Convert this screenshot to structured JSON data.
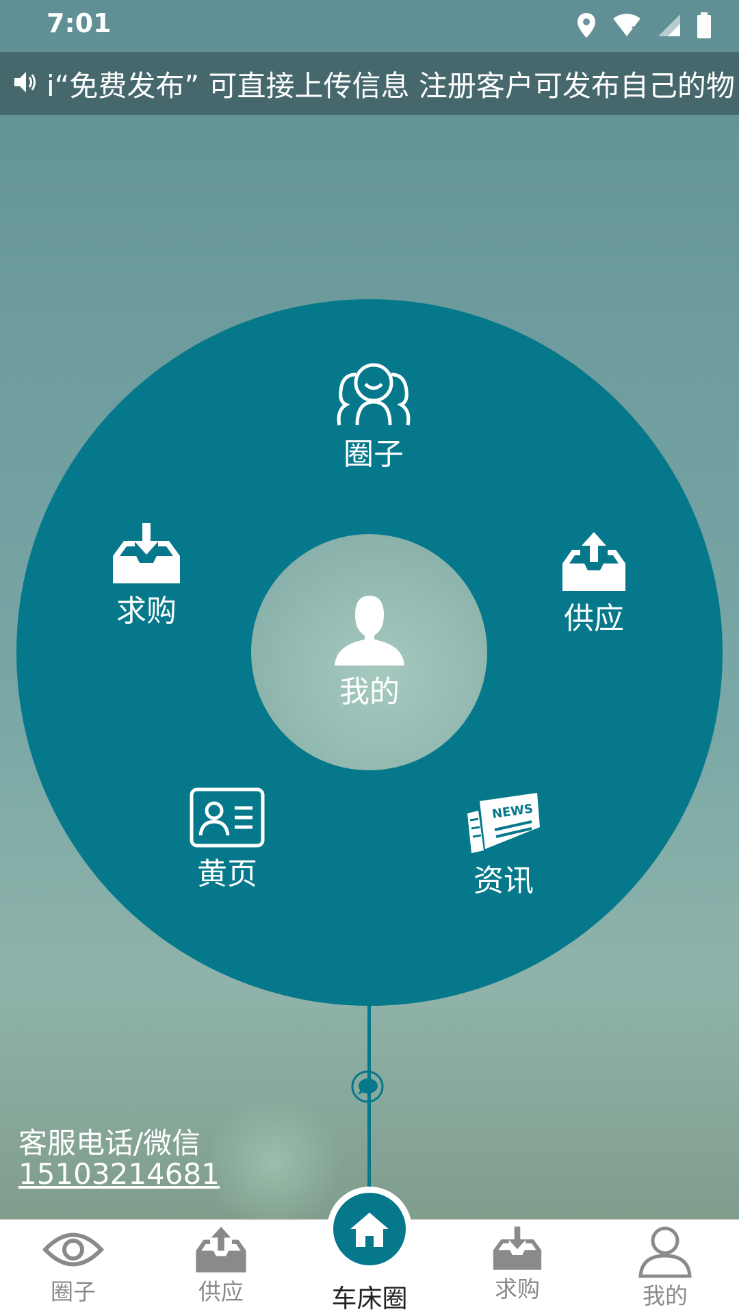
{
  "status_bar": {
    "time": "7:01"
  },
  "marquee": {
    "text": "i“免费发布” 可直接上传信息   注册客户可发布自己的物"
  },
  "circle_menu": {
    "top": {
      "label": "圈子",
      "icon": "people-group-icon"
    },
    "left": {
      "label": "求购",
      "icon": "inbox-download-icon"
    },
    "right": {
      "label": "供应",
      "icon": "inbox-upload-icon"
    },
    "center": {
      "label": "我的",
      "icon": "user-silhouette-icon"
    },
    "bottom_left": {
      "label": "黄页",
      "icon": "contact-card-icon"
    },
    "bottom_right": {
      "label": "资讯",
      "icon": "newspaper-icon"
    }
  },
  "contact": {
    "label": "客服电话/微信",
    "phone": "15103214681"
  },
  "bottom_nav": {
    "items": [
      {
        "label": "圈子",
        "icon": "eye-icon"
      },
      {
        "label": "供应",
        "icon": "inbox-upload-icon"
      },
      {
        "label": "车床圈",
        "icon": "home-icon"
      },
      {
        "label": "求购",
        "icon": "inbox-download-icon"
      },
      {
        "label": "我的",
        "icon": "user-outline-icon"
      }
    ]
  },
  "colors": {
    "accent": "#05788b",
    "nav_inactive": "#8a8a8a"
  }
}
